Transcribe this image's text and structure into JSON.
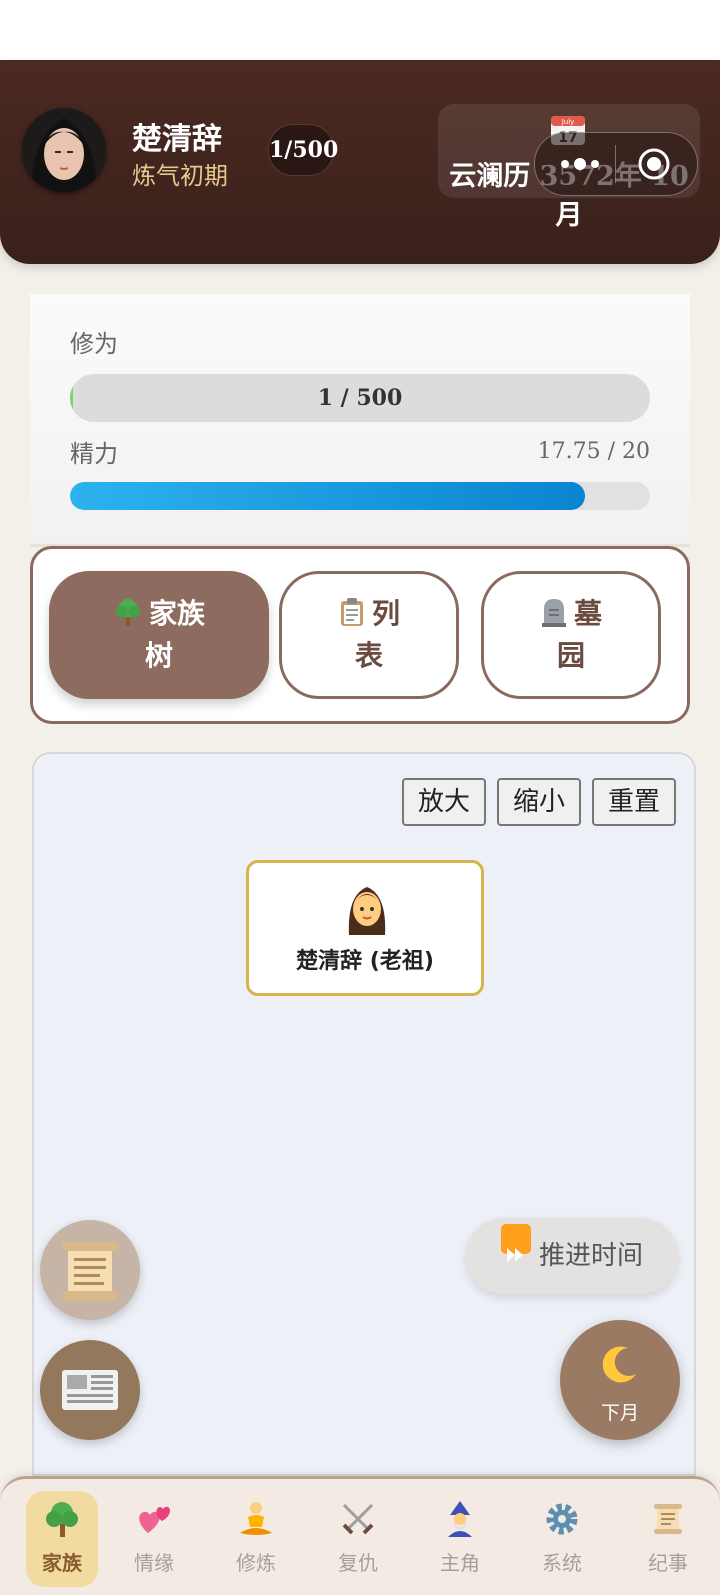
{
  "header": {
    "name": "楚清辞",
    "realm": "炼气初期",
    "badge": "1/500",
    "date": "云澜历 3572年 10月",
    "calendar_month": "July",
    "calendar_day": "17"
  },
  "stats": {
    "xiuwei_label": "修为",
    "xiuwei_text": "1 / 500",
    "xiuwei_progress": 0.002,
    "jingli_label": "精力",
    "jingli_text": "17.75 / 20",
    "jingli_progress": 0.8875
  },
  "tabs": [
    {
      "line1": "家族",
      "line2": "树",
      "active": true
    },
    {
      "line1": "列",
      "line2": "表",
      "active": false
    },
    {
      "line1": "墓",
      "line2": "园",
      "active": false
    }
  ],
  "tree": {
    "zoom_in": "放大",
    "zoom_out": "缩小",
    "reset": "重置",
    "node_name": "楚清辞 (老祖)"
  },
  "actions": {
    "advance_time": "推进时间",
    "next_month": "下月"
  },
  "nav": [
    {
      "label": "家族",
      "icon": "tree-icon",
      "active": true
    },
    {
      "label": "情缘",
      "icon": "hearts-icon",
      "active": false
    },
    {
      "label": "修炼",
      "icon": "meditation-icon",
      "active": false
    },
    {
      "label": "复仇",
      "icon": "swords-icon",
      "active": false
    },
    {
      "label": "主角",
      "icon": "mage-icon",
      "active": false
    },
    {
      "label": "系统",
      "icon": "gear-icon",
      "active": false
    },
    {
      "label": "纪事",
      "icon": "scroll-icon",
      "active": false
    }
  ],
  "colors": {
    "header_bg": "#3a201b",
    "accent_brown": "#8d6b5f",
    "energy_blue": "#0a84d0",
    "gold_border": "#d8b24a"
  }
}
